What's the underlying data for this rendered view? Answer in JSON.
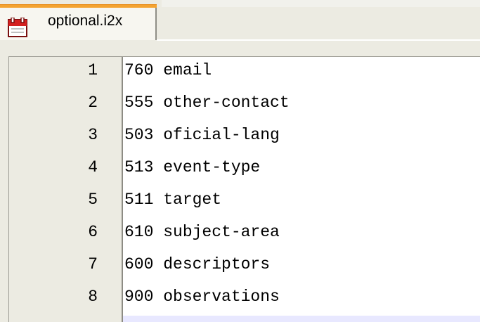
{
  "tab": {
    "label": "optional.i2x",
    "icon": "document-icon",
    "accent_color": "#f4a330"
  },
  "editor": {
    "lines": [
      {
        "num": "1",
        "text": "760 email"
      },
      {
        "num": "2",
        "text": "555 other-contact"
      },
      {
        "num": "3",
        "text": "503 oficial-lang"
      },
      {
        "num": "4",
        "text": "513 event-type"
      },
      {
        "num": "5",
        "text": "511 target"
      },
      {
        "num": "6",
        "text": "610 subject-area"
      },
      {
        "num": "7",
        "text": "600 descriptors"
      },
      {
        "num": "8",
        "text": "900 observations"
      }
    ]
  }
}
